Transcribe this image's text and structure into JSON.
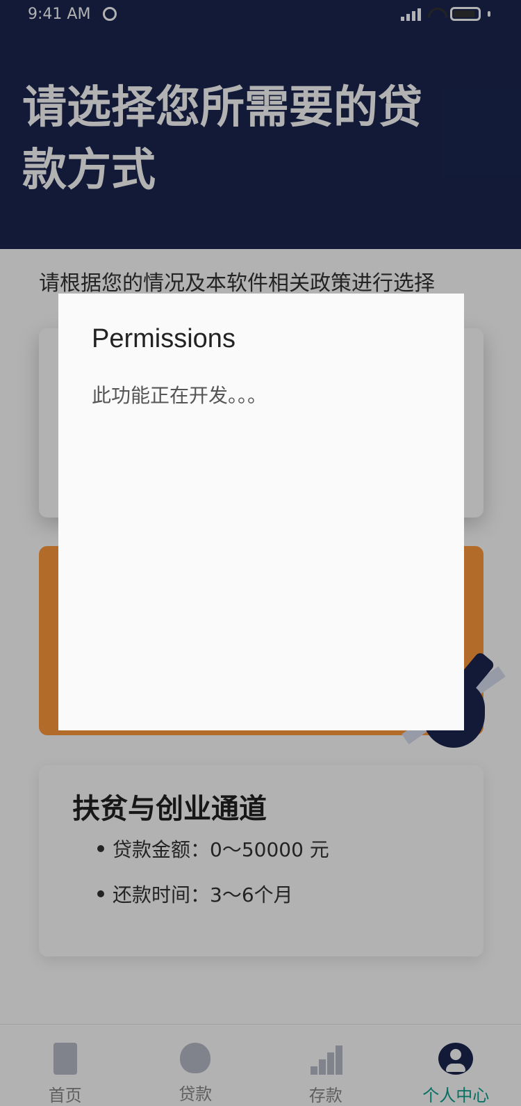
{
  "status_bar": {
    "time": "9:41 AM"
  },
  "header": {
    "title": "请选择您所需要的贷款方式"
  },
  "subtitle": "请根据您的情况及本软件相关政策进行选择",
  "cards": {
    "card3": {
      "title": "扶贫与创业通道",
      "bullets": [
        "贷款金额：0～50000 元",
        "还款时间：3～6个月"
      ]
    }
  },
  "dialog": {
    "title": "Permissions",
    "body": "此功能正在开发。。。"
  },
  "tabbar": {
    "items": [
      {
        "label": "首页",
        "icon": "building-icon",
        "active": false
      },
      {
        "label": "贷款",
        "icon": "moneybag-icon",
        "active": false
      },
      {
        "label": "存款",
        "icon": "chart-icon",
        "active": false
      },
      {
        "label": "个人中心",
        "icon": "user-icon",
        "active": true
      }
    ]
  },
  "colors": {
    "primary": "#1a2650",
    "accent": "#0aa18e",
    "card_orange": "#ff9a3c"
  }
}
